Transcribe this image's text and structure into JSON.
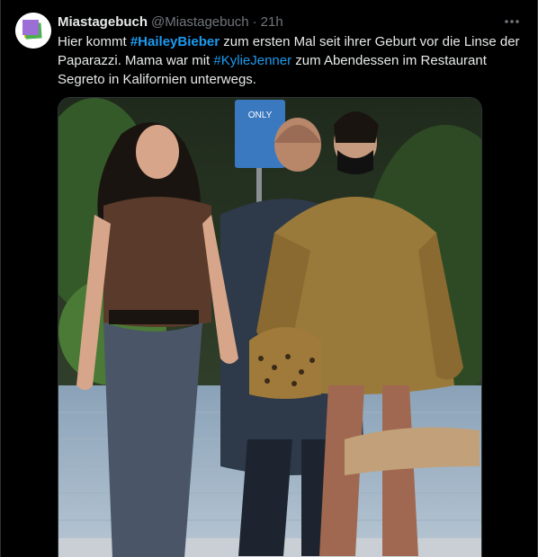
{
  "tweet": {
    "display_name": "Miastagebuch",
    "handle": "@Miastagebuch",
    "separator": "·",
    "time": "21h",
    "text": {
      "part1": "Hier kommt ",
      "hashtag1": "#HaileyBieber",
      "part2": " zum ersten Mal seit ihrer Geburt vor die Linse der Paparazzi. Mama war mit ",
      "hashtag2": "#KylieJenner",
      "part3": " zum Abendessen im Restaurant Segreto in Kalifornien unterwegs."
    }
  },
  "media": {
    "sign_text": "ONLY"
  },
  "colors": {
    "background": "#000000",
    "text": "#e7e9ea",
    "muted": "#71767b",
    "link": "#1d9bf0",
    "border": "#2f3336"
  },
  "icons": {
    "more": "more-icon",
    "avatar": "avatar"
  }
}
